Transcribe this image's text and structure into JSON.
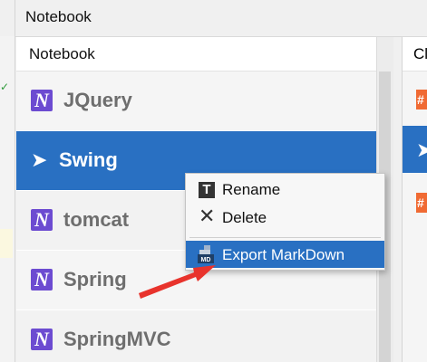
{
  "window": {
    "title": "Notebook"
  },
  "notebook_panel": {
    "header": "Notebook",
    "items": [
      {
        "label": "JQuery",
        "icon": "onenote-notebook-icon",
        "selected": false
      },
      {
        "label": "Swing",
        "icon": "chevron-right-icon",
        "selected": true
      },
      {
        "label": "tomcat",
        "icon": "onenote-notebook-icon",
        "selected": false
      },
      {
        "label": "Spring",
        "icon": "onenote-notebook-icon",
        "selected": false
      },
      {
        "label": "SpringMVC",
        "icon": "onenote-notebook-icon",
        "selected": false
      }
    ]
  },
  "right_panel": {
    "header": "Cl",
    "rows": [
      "#",
      "",
      "#"
    ]
  },
  "context_menu": {
    "items": [
      {
        "label": "Rename",
        "icon": "text-t-icon"
      },
      {
        "label": "Delete",
        "icon": "close-x-icon"
      },
      {
        "label": "Export MarkDown",
        "icon": "markdown-export-icon",
        "highlighted": true
      }
    ]
  },
  "glyphs": {
    "notebook_letter": "N",
    "rename_letter": "T",
    "delete_glyph": "✕",
    "arrow_glyph": "➤",
    "check_glyph": "✓"
  },
  "colors": {
    "selection": "#2970c2",
    "notebook_icon": "#6c4bd1",
    "markdown_badge": "#f06a33",
    "annotation_arrow": "#e8332c"
  }
}
